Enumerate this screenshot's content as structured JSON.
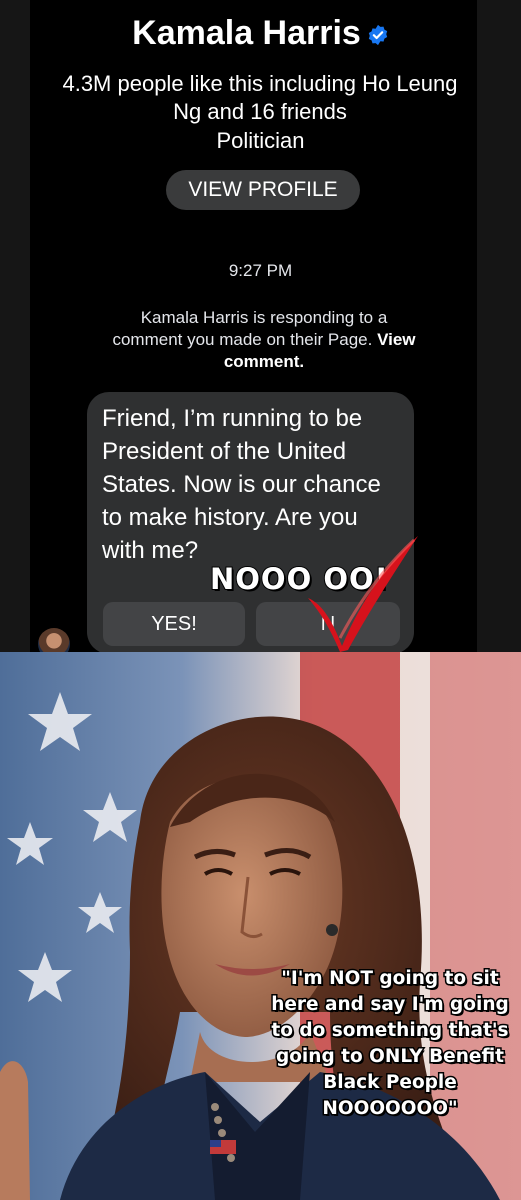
{
  "page": {
    "name": "Kamala Harris",
    "likes_text": "4.3M people like this including Ho Leung Ng and 16 friends",
    "category": "Politician",
    "view_profile_label": "VIEW PROFILE",
    "timestamp": "9:27 PM",
    "notice_prefix": "Kamala Harris is responding to a comment you made on their Page.",
    "notice_link": "View comment."
  },
  "message": {
    "text": "Friend, I’m running to be President of the United States. Now is our chance to make history. Are you with me?",
    "reply_yes": "YES!",
    "reply_no": "N"
  },
  "overlay": {
    "shout": "NOOO  OO!",
    "quote": "\"I'm NOT going to sit here and say I'm going to do something that's going to ONLY Benefit Black People NOOOOOOO\""
  },
  "icons": [
    "verified-badge-icon",
    "checkmark-icon",
    "avatar"
  ],
  "colors": {
    "verified": "#1877f2",
    "check": "#d6121c",
    "bubble": "#2f3031",
    "button": "#434446"
  }
}
